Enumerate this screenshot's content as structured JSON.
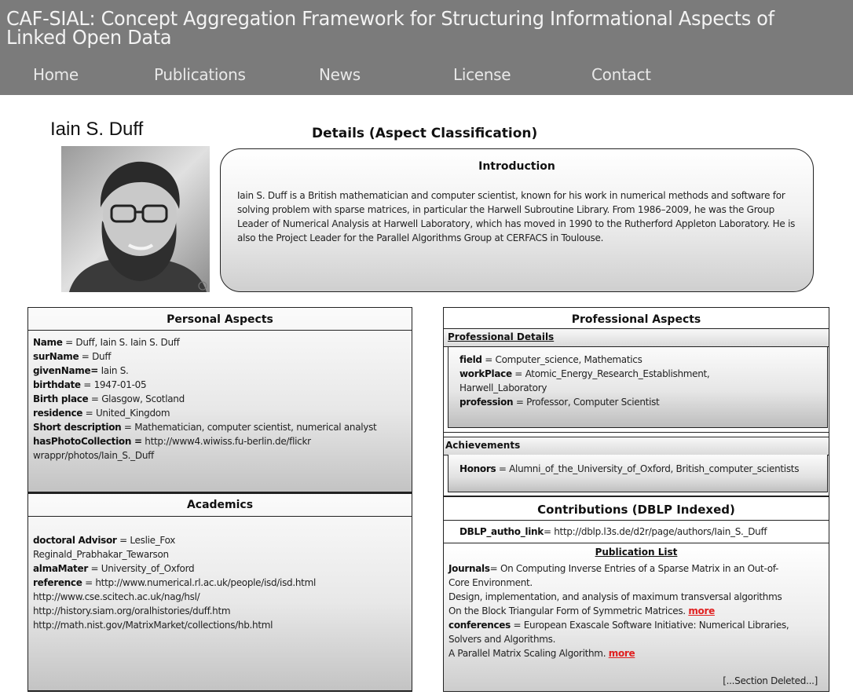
{
  "site": {
    "title": "CAF-SIAL: Concept Aggregation Framework for Structuring Informational Aspects of Linked Open Data"
  },
  "nav": {
    "items": [
      "Home",
      "Publications",
      "News",
      "License",
      "Contact"
    ]
  },
  "person": {
    "name": "Iain S. Duff",
    "photo_alt": "portrait-photo"
  },
  "details": {
    "title": "Details (Aspect Classification)"
  },
  "intro": {
    "title": "Introduction",
    "text": "Iain S. Duff is a British mathematician and computer scientist, known for his work in numerical methods and software for solving problem with sparse matrices, in particular the Harwell Subroutine Library. From 1986–2009, he was the Group Leader of Numerical Analysis at Harwell Laboratory, which has moved in 1990 to the Rutherford Appleton Laboratory. He is also the Project Leader for the Parallel Algorithms Group at CERFACS in Toulouse."
  },
  "personal": {
    "title": "Personal Aspects",
    "rows": [
      {
        "key": "Name",
        "sep": " = ",
        "value": "Duff, Iain S. Iain S. Duff"
      },
      {
        "key": "surName",
        "sep": " = ",
        "value": "Duff"
      },
      {
        "key": "givenName=",
        "sep": " ",
        "value": "Iain S."
      },
      {
        "key": "birthdate",
        "sep": " = ",
        "value": "1947-01-05"
      },
      {
        "key": "Birth place",
        "sep": " = ",
        "value": "Glasgow, Scotland"
      },
      {
        "key": "residence",
        "sep": " = ",
        "value": "United_Kingdom"
      },
      {
        "key": "Short description",
        "sep": " = ",
        "value": "Mathematician, computer scientist, numerical analyst"
      },
      {
        "key": "hasPhotoCollection =",
        "sep": " ",
        "value": "http://www4.wiwiss.fu-berlin.de/flickrwrappr/photos/Iain_S._Duff"
      }
    ]
  },
  "academics": {
    "title": "Academics",
    "advisor_key": "doctoral Advisor",
    "advisor_value": "Leslie_Fox",
    "advisor_value2": "Reginald_Prabhakar_Tewarson",
    "alma_key": "almaMater",
    "alma_value": "University_of_Oxford",
    "ref_key": "reference",
    "ref_value": "http://www.numerical.rl.ac.uk/people/isd/isd.html",
    "ref_lines": [
      "http://www.cse.scitech.ac.uk/nag/hsl/",
      "http://history.siam.org/oralhistories/duff.htm",
      "http://math.nist.gov/MatrixMarket/collections/hb.html"
    ]
  },
  "professional": {
    "title": "Professional Aspects",
    "details_head": "Professional Details",
    "field_key": "field",
    "field_value": "Computer_science, Mathematics",
    "workplace_key": "workPlace",
    "workplace_value": "Atomic_Energy_Research_Establishment,",
    "workplace_value2": "Harwell_Laboratory",
    "profession_key": "profession",
    "profession_value": "Professor, Computer Scientist",
    "achievements_head": "Achievements",
    "honors_key": "Honors",
    "honors_value": "Alumni_of_the_University_of_Oxford, British_computer_scientists"
  },
  "contributions": {
    "title": "Contributions (DBLP Indexed)",
    "dblp_key": "DBLP_autho_link",
    "dblp_value": "http://dblp.l3s.de/d2r/page/authors/Iain_S._Duff",
    "publist_head": "Publication List",
    "journals_key": "Journals",
    "journals_line1": "On Computing Inverse Entries of a Sparse Matrix in an Out-of-",
    "journals_line2": "Core Environment.",
    "journals_line3": "Design, implementation, and analysis of maximum transversal algorithms",
    "journals_line4": "On the Block Triangular Form of Symmetric Matrices.",
    "more_label": "more",
    "conf_key": "conferences",
    "conf_line1": "European Exascale Software Initiative: Numerical Libraries,",
    "conf_line2": "Solvers and Algorithms.",
    "conf_line3": "A Parallel Matrix Scaling Algorithm.",
    "deleted_note": "[...Section Deleted...]"
  }
}
